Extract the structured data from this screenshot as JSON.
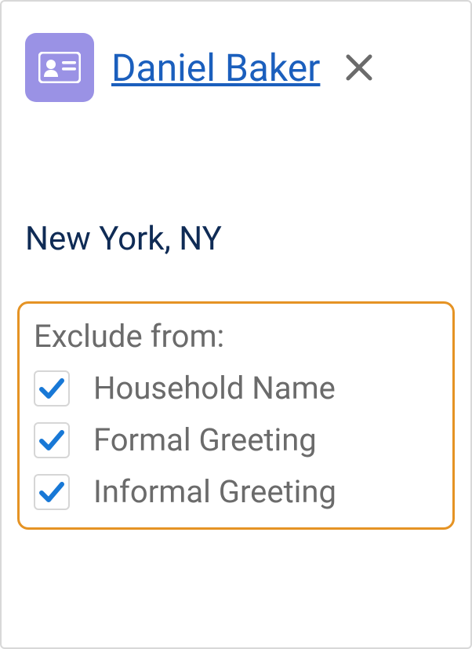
{
  "contact": {
    "name": "Daniel Baker",
    "location": "New York, NY"
  },
  "icons": {
    "contact": "id-card-icon",
    "close": "close-icon",
    "check": "check-icon"
  },
  "exclude": {
    "title": "Exclude from:",
    "items": [
      {
        "label": "Household Name",
        "checked": true
      },
      {
        "label": "Formal Greeting",
        "checked": true
      },
      {
        "label": "Informal Greeting",
        "checked": true
      }
    ]
  },
  "colors": {
    "iconBg": "#9a92e5",
    "link": "#1b5fbd",
    "muted": "#6b6b6b",
    "dark": "#0f2b55",
    "highlight": "#e59324",
    "check": "#1878d6"
  }
}
